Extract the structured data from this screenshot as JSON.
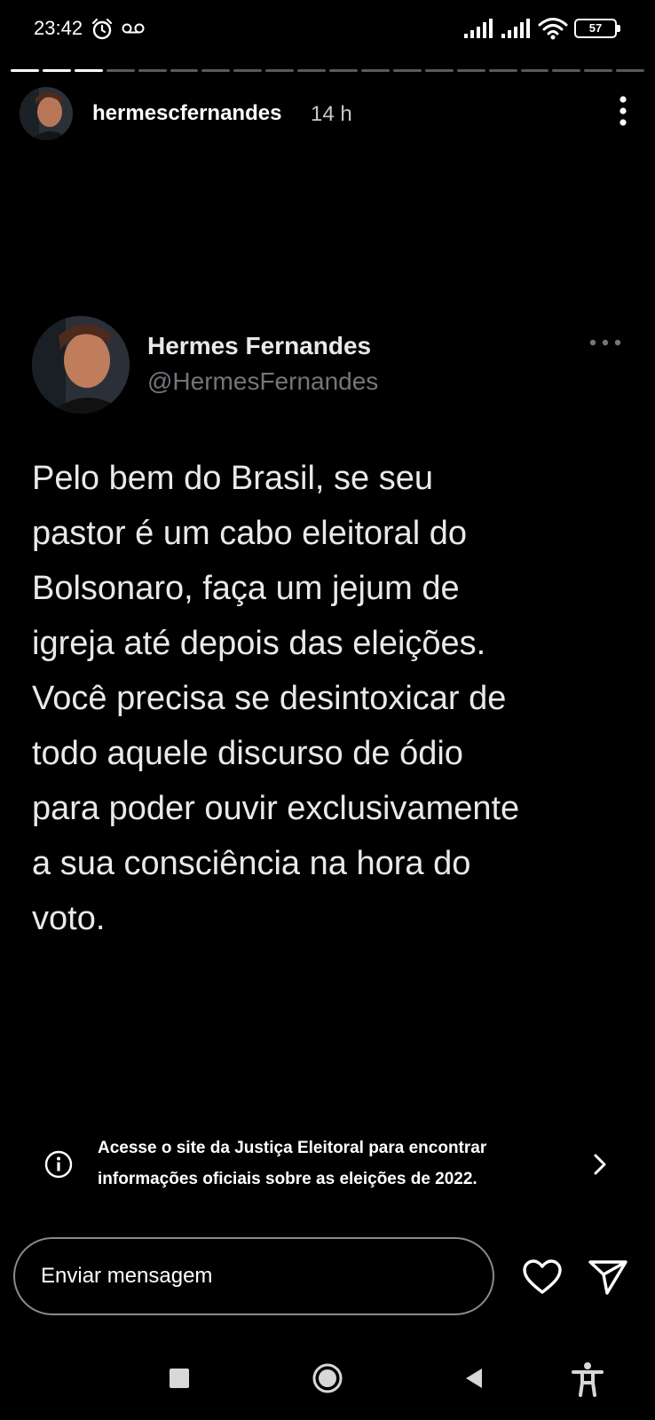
{
  "status_bar": {
    "time": "23:42",
    "battery": "57",
    "icons": [
      "alarm-icon",
      "voicemail-icon",
      "signal-icon",
      "signal-icon",
      "wifi-icon",
      "battery-icon"
    ]
  },
  "story": {
    "segments_total": 20,
    "segments_viewed": 3,
    "username": "hermescfernandes",
    "time_ago": "14 h"
  },
  "tweet": {
    "name": "Hermes Fernandes",
    "handle": "@HermesFernandes",
    "text_lines": [
      "Pelo bem do Brasil, se seu",
      "pastor é um cabo eleitoral do",
      "Bolsonaro, faça um jejum de",
      "igreja até depois das eleições.",
      "Você precisa se desintoxicar de",
      "todo aquele discurso de ódio",
      "para poder ouvir exclusivamente",
      "a sua consciência na hora do",
      "voto."
    ]
  },
  "banner": {
    "line1": "Acesse o site da Justiça Eleitoral para encontrar",
    "line2": "informações oficiais sobre as eleições de 2022."
  },
  "reply": {
    "placeholder": "Enviar mensagem"
  },
  "colors": {
    "background": "#000000",
    "tweet_text": "#e7e9ea",
    "handle": "#71767b"
  }
}
